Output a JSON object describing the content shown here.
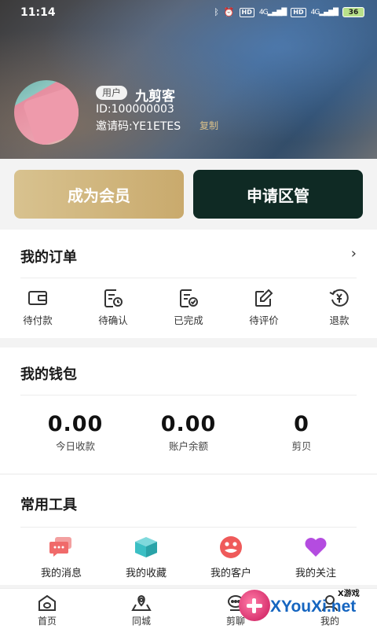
{
  "status_bar": {
    "time": "11:14",
    "battery": "36",
    "network_1": "4G",
    "network_2": "4G",
    "hd": "HD"
  },
  "profile": {
    "role": "用户",
    "name": "九剪客",
    "id": "ID:100000003",
    "invite_code": "邀请码:YE1ETES",
    "copy": "复制"
  },
  "actions": {
    "member": "成为会员",
    "manager": "申请区管"
  },
  "orders": {
    "title": "我的订单",
    "chevron": "›",
    "items": [
      {
        "label": "待付款",
        "icon": "wallet-icon"
      },
      {
        "label": "待确认",
        "icon": "pending-confirm-icon"
      },
      {
        "label": "已完成",
        "icon": "completed-icon"
      },
      {
        "label": "待评价",
        "icon": "review-icon"
      },
      {
        "label": "退款",
        "icon": "refund-icon"
      }
    ]
  },
  "wallet": {
    "title": "我的钱包",
    "items": [
      {
        "value": "0.00",
        "label": "今日收款"
      },
      {
        "value": "0.00",
        "label": "账户余额"
      },
      {
        "value": "0",
        "label": "剪贝"
      }
    ]
  },
  "tools": {
    "title": "常用工具",
    "items": [
      {
        "label": "我的消息",
        "icon": "message-icon",
        "color": "#f06a6a"
      },
      {
        "label": "我的收藏",
        "icon": "box-icon",
        "color": "#3bbfc4"
      },
      {
        "label": "我的客户",
        "icon": "customer-icon",
        "color": "#ef5a5a"
      },
      {
        "label": "我的关注",
        "icon": "heart-icon",
        "color": "#b44ce0"
      }
    ]
  },
  "nav": [
    {
      "label": "首页",
      "icon": "home-icon"
    },
    {
      "label": "同城",
      "icon": "location-icon"
    },
    {
      "label": "",
      "icon": ""
    },
    {
      "label": "剪聊",
      "icon": "chat-icon"
    },
    {
      "label": "我的",
      "icon": "profile-icon"
    }
  ],
  "watermark": {
    "small": "X游戏",
    "text": "XYouXi.net"
  }
}
